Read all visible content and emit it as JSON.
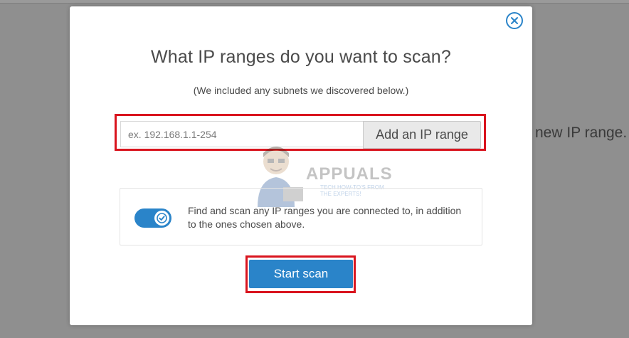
{
  "background": {
    "partial_text": "new IP range."
  },
  "modal": {
    "title": "What IP ranges do you want to scan?",
    "subtitle": "(We included any subnets we discovered below.)",
    "ip_input": {
      "value": "",
      "placeholder": "ex. 192.168.1.1-254"
    },
    "add_range_label": "Add an IP range",
    "option": {
      "toggle_on": true,
      "text": "Find and scan any IP ranges you are connected to, in addition to the ones chosen above."
    },
    "start_scan_label": "Start scan",
    "close_icon": "close-circle-icon"
  },
  "watermark": {
    "title": "APPUALS",
    "subtitle": "TECH HOW-TO'S FROM THE EXPERTS!"
  },
  "colors": {
    "accent": "#2a84c9",
    "highlight": "#d9141e",
    "overlay": "#8f8f8f"
  }
}
